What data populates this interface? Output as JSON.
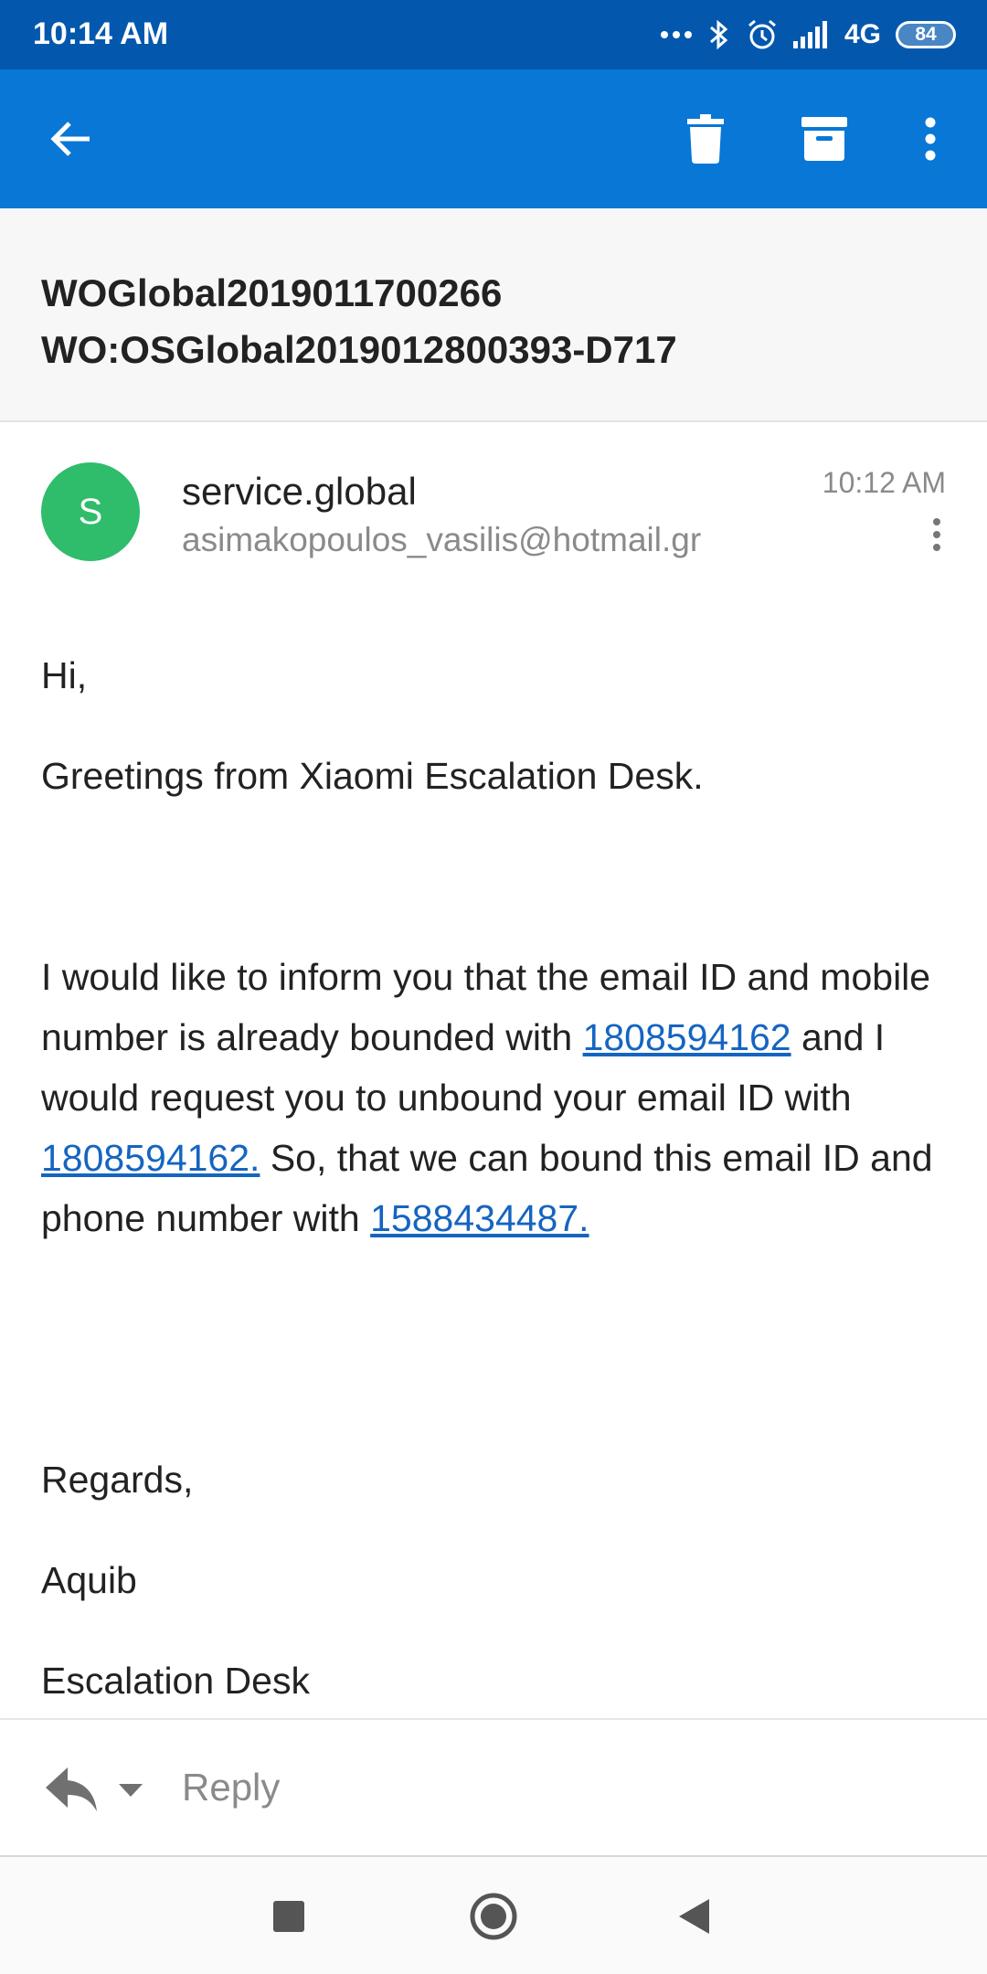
{
  "status_bar": {
    "time": "10:14 AM",
    "network": "4G",
    "battery": "84"
  },
  "icons": {
    "back": "arrow-left",
    "delete": "trash",
    "archive": "archive-box",
    "more": "more-vertical",
    "reply": "reply-arrow",
    "reply_dropdown": "caret-down",
    "nav_recents": "square",
    "nav_home": "circle",
    "nav_back": "triangle-left"
  },
  "colors": {
    "status_bar": "#0358ad",
    "app_bar": "#0877d6",
    "avatar": "#2fbc6b",
    "link": "#1565c0"
  },
  "email": {
    "subject_line1": "WOGlobal2019011700266",
    "subject_line2": "WO:OSGlobal2019012800393-D717",
    "sender": {
      "avatar_initial": "S",
      "name": "service.global",
      "address": "asimakopoulos_vasilis@hotmail.gr",
      "time": "10:12 AM"
    },
    "body": {
      "greeting": "Hi,",
      "intro": "Greetings from Xiaomi Escalation Desk.",
      "paragraph": {
        "part1": "I would like to inform you that the email ID and mobile number is already bounded with ",
        "link1": "1808594162",
        "part2": " and I would request you to unbound your email ID with ",
        "link2": "1808594162.",
        "part3": " So, that we can bound this email ID and phone number with ",
        "link3": "1588434487."
      },
      "closing": "Regards,",
      "signature_name": "Aquib",
      "signature_team": "Escalation Desk"
    }
  },
  "reply_bar": {
    "label": "Reply"
  }
}
